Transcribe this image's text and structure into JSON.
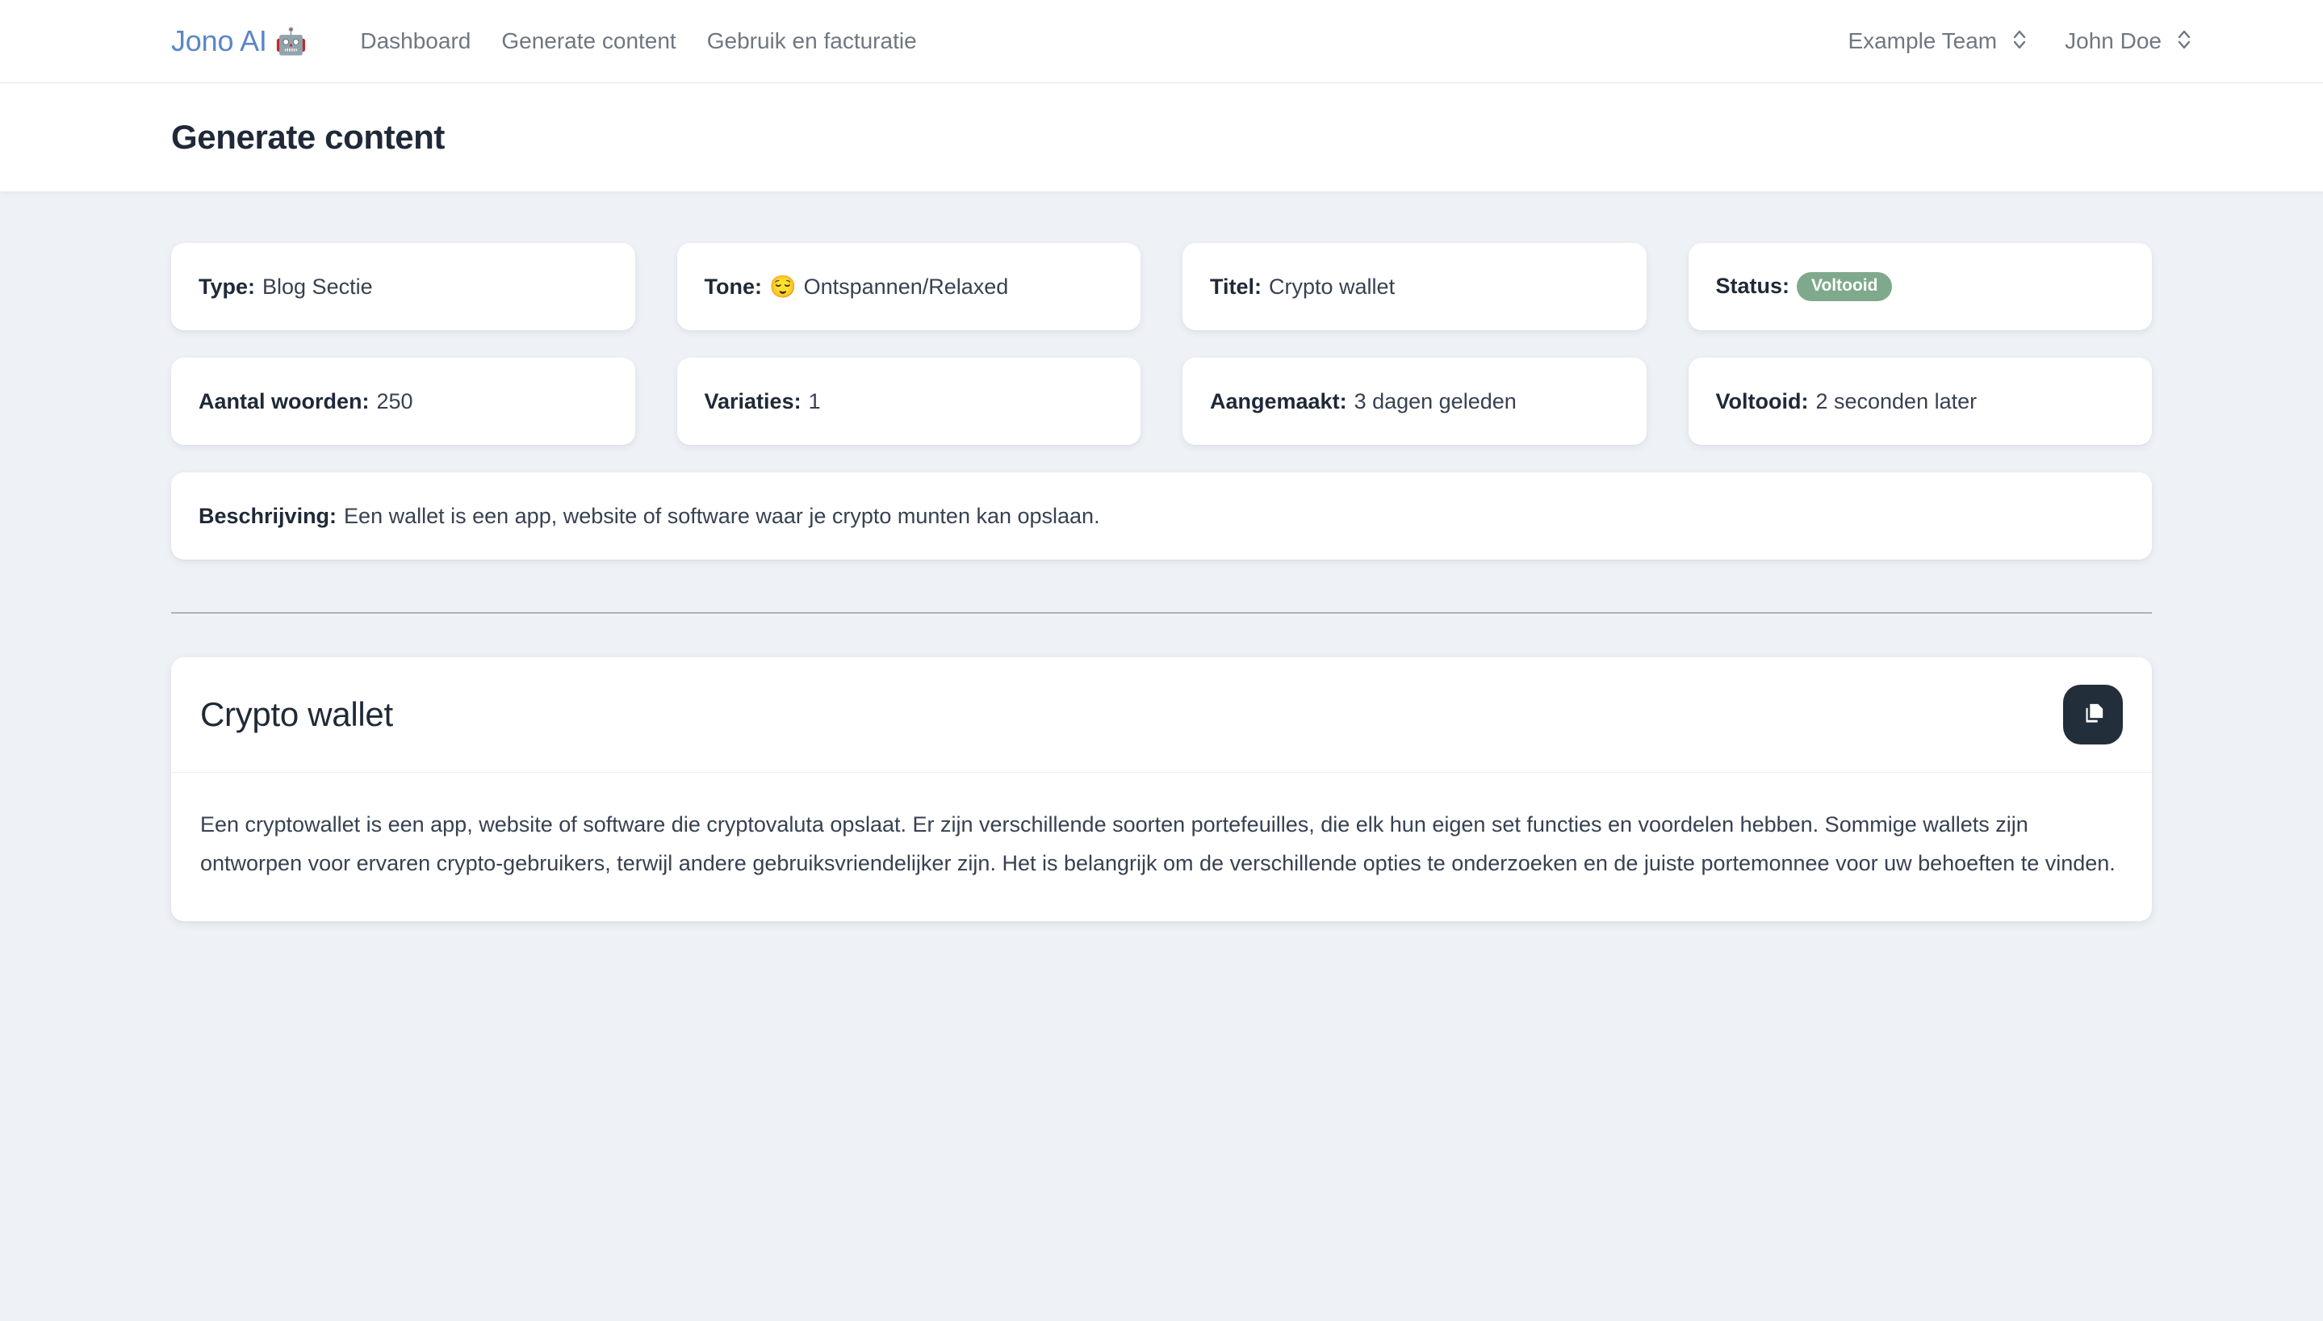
{
  "navbar": {
    "brand": {
      "text": "Jono AI",
      "emoji": "🤖",
      "color": "#5b85c8",
      "emoji_icon_name": "robot-icon"
    },
    "links": [
      {
        "label": "Dashboard"
      },
      {
        "label": "Generate content"
      },
      {
        "label": "Gebruik en facturatie"
      }
    ],
    "team_selector": {
      "value": "Example Team",
      "icon": "chevron-up-down-icon"
    },
    "user_selector": {
      "value": "John Doe",
      "icon": "chevron-up-down-icon"
    }
  },
  "header": {
    "title": "Generate content"
  },
  "info_cards": [
    {
      "label": "Type:",
      "value": "Blog Sectie"
    },
    {
      "label": "Tone:",
      "emoji": "😌",
      "value": "Ontspannen/Relaxed"
    },
    {
      "label": "Titel:",
      "value": "Crypto wallet"
    },
    {
      "label": "Status:",
      "badge": "Voltooid",
      "badge_color": "#7fa98c"
    },
    {
      "label": "Aantal woorden:",
      "value": "250"
    },
    {
      "label": "Variaties:",
      "value": "1"
    },
    {
      "label": "Aangemaakt:",
      "value": "3 dagen geleden"
    },
    {
      "label": "Voltooid:",
      "value": "2 seconden later"
    }
  ],
  "description_card": {
    "label": "Beschrijving:",
    "value": "Een wallet is een app, website of software waar je crypto munten kan opslaan."
  },
  "result": {
    "title": "Crypto wallet",
    "copy_button_icon": "copy-icon",
    "body": "Een cryptowallet is een app, website of software die cryptovaluta opslaat. Er zijn verschillende soorten portefeuilles, die elk hun eigen set functies en voordelen hebben. Sommige wallets zijn ontworpen voor ervaren crypto-gebruikers, terwijl andere gebruiksvriendelijker zijn. Het is belangrijk om de verschillende opties te onderzoeken en de juiste portemonnee voor uw behoeften te vinden."
  }
}
